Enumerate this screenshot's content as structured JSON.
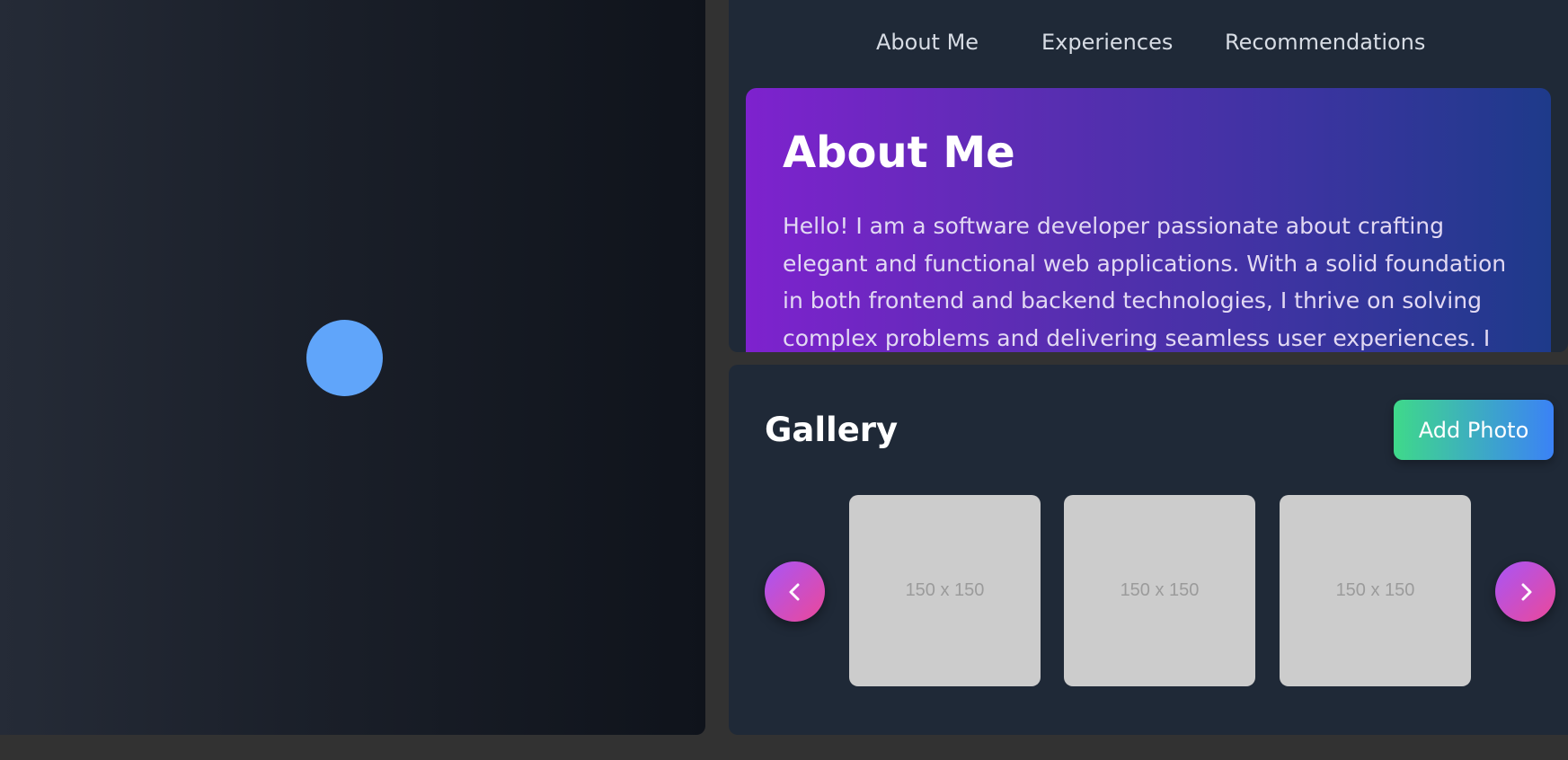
{
  "nav": {
    "links": [
      "About Me",
      "Experiences",
      "Recommendations"
    ]
  },
  "about": {
    "title": "About Me",
    "text": "Hello! I am a software developer passionate about crafting elegant and functional web applications. With a solid foundation in both frontend and backend technologies, I thrive on solving complex problems and delivering seamless user experiences. I am"
  },
  "gallery": {
    "title": "Gallery",
    "add_button": "Add Photo",
    "photos": [
      "150 x 150",
      "150 x 150",
      "150 x 150"
    ],
    "prev_icon": "chevron-left-icon",
    "next_icon": "chevron-right-icon"
  },
  "colors": {
    "loader_dot": "#60a5fa",
    "card_bg": "#1f2937",
    "about_gradient": [
      "#7e22ce",
      "#1e3a8a"
    ],
    "add_button_gradient": [
      "#3fd98a",
      "#3b82f6"
    ],
    "arrow_gradient": [
      "#a855f7",
      "#ec4899"
    ]
  }
}
